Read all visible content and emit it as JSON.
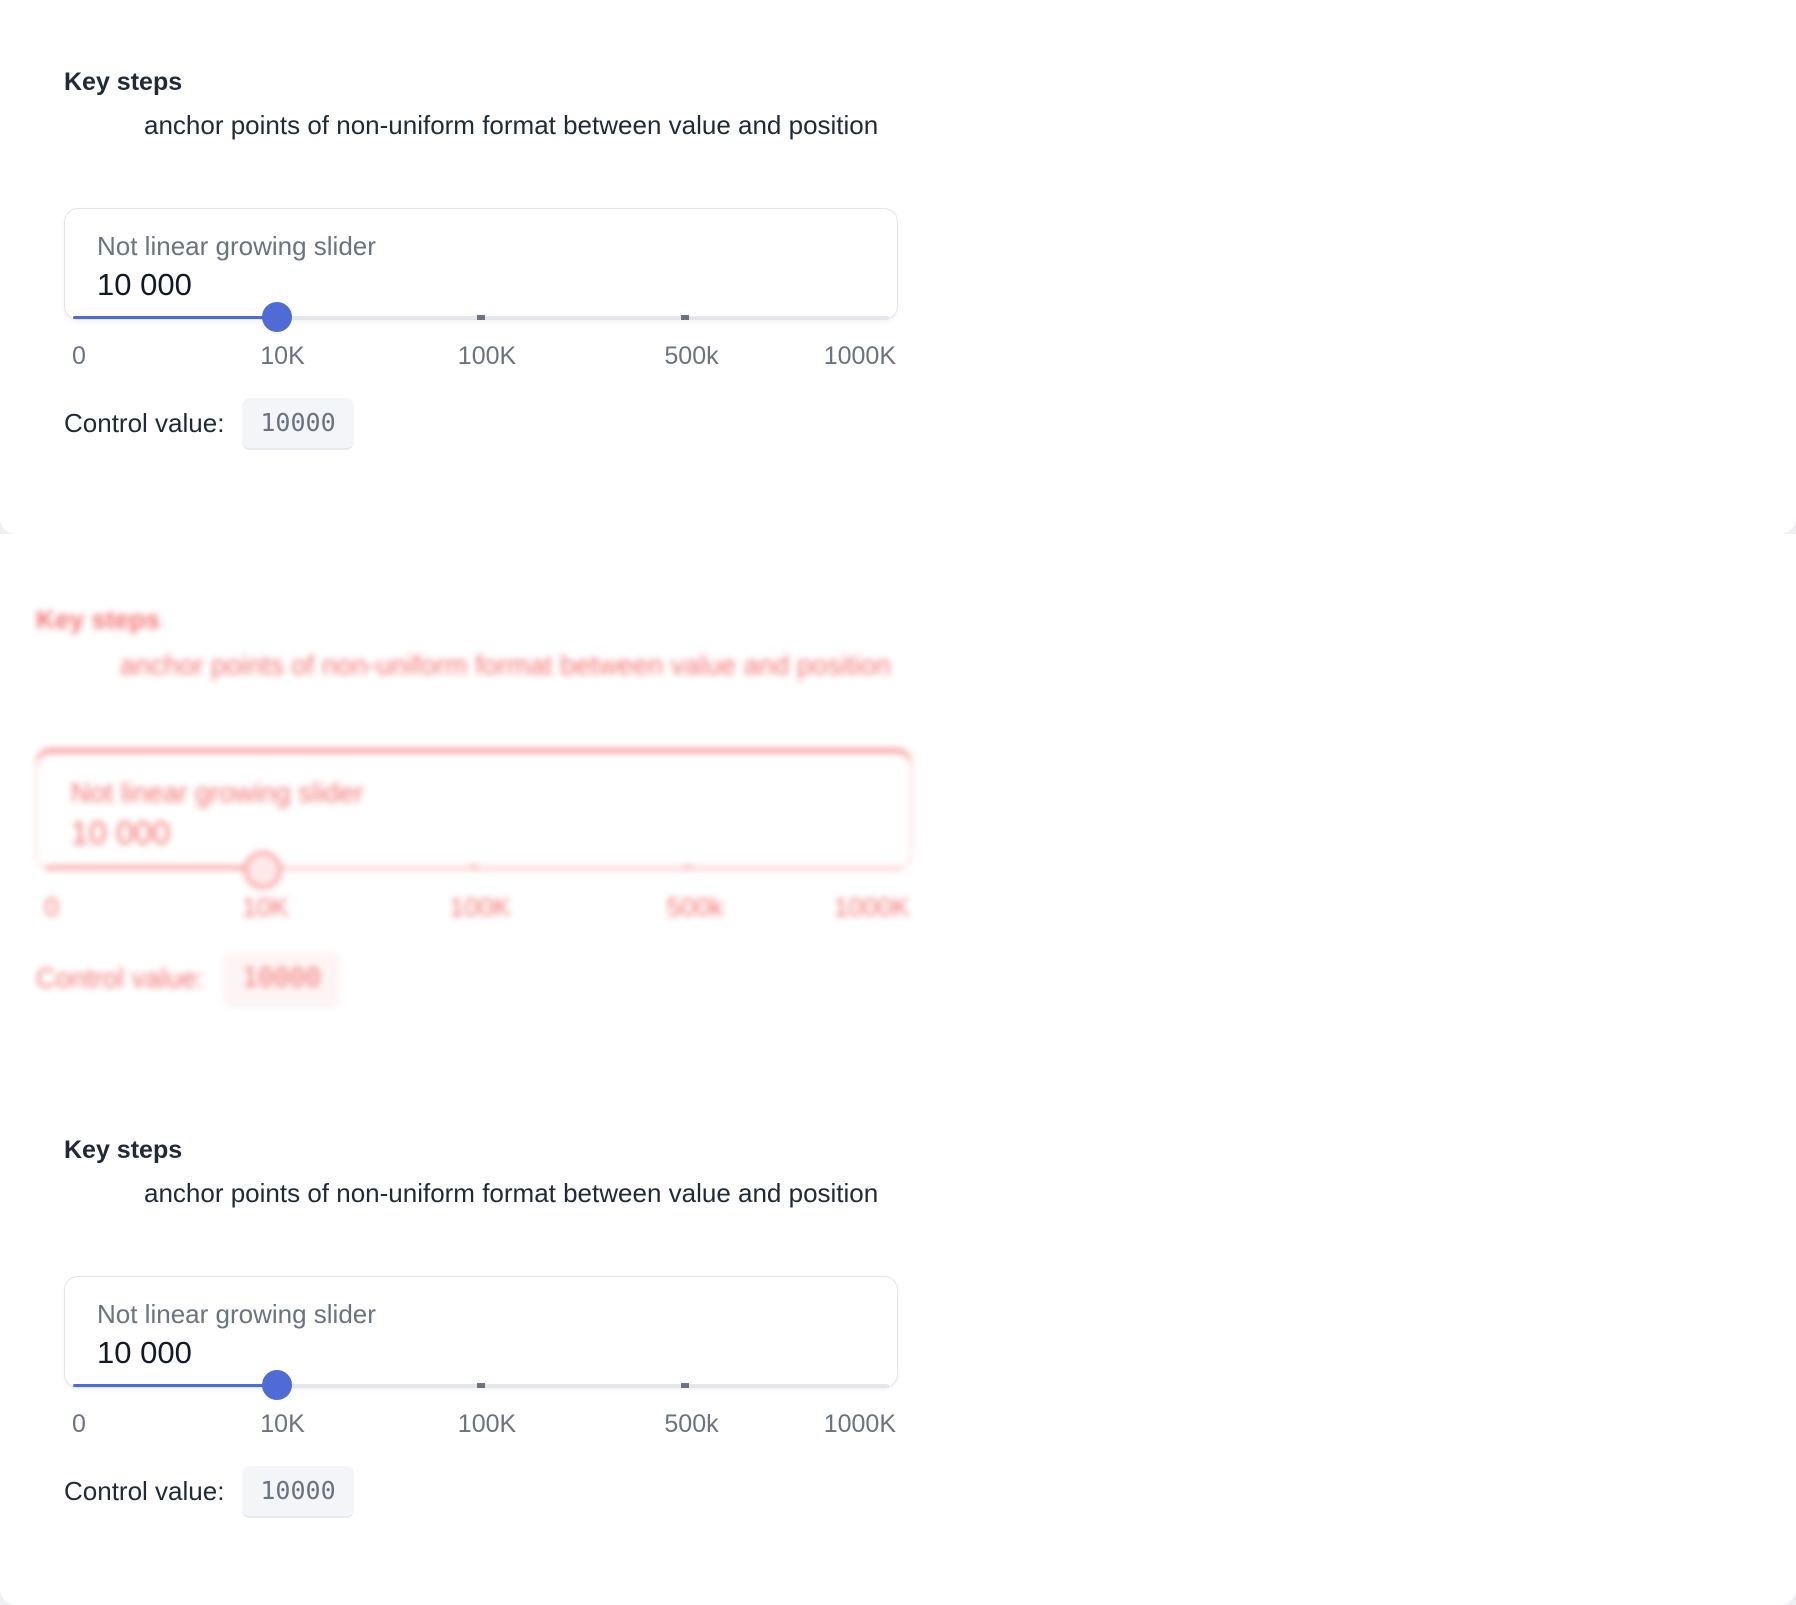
{
  "colors": {
    "accent": "#4f6bd6",
    "panel": "#ffffff",
    "page_background": "#eef0f3",
    "ghost": "#ef4444"
  },
  "sections": [
    {
      "heading": "Key steps",
      "subheading": "anchor points of non-uniform format between value and position",
      "slider": {
        "label": "Not linear growing slider",
        "display_value": "10 000",
        "value": 10000,
        "steps": [
          "0",
          "10K",
          "100K",
          "500k",
          "1000K"
        ],
        "step_values": [
          0,
          10000,
          100000,
          500000,
          1000000
        ]
      },
      "control": {
        "label": "Control value:",
        "value": "10000"
      }
    }
  ]
}
